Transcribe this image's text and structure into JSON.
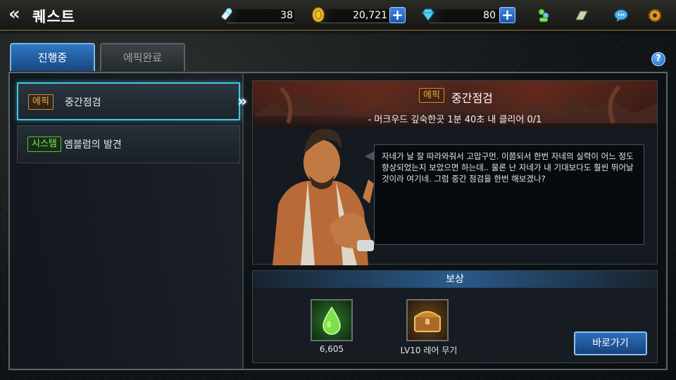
{
  "header": {
    "back_glyph": "«",
    "title": "퀘스트",
    "stamina": "38",
    "gold": "20,721",
    "gems": "80",
    "plus_glyph": "+",
    "icons": [
      "flashlight-icon",
      "gold-coin-icon",
      "diamond-icon",
      "people-icon",
      "inventory-icon",
      "chat-icon",
      "settings-gear-icon"
    ]
  },
  "tabs": [
    {
      "label": "진행중",
      "active": true
    },
    {
      "label": "에픽완료",
      "active": false
    }
  ],
  "help_glyph": "?",
  "quests": [
    {
      "tag": "에픽",
      "tag_type": "epic",
      "name": "중간점검",
      "selected": true
    },
    {
      "tag": "시스템",
      "tag_type": "system",
      "name": "엠블럼의 발견",
      "selected": false
    }
  ],
  "selected_arrow": "»",
  "detail": {
    "tag": "에픽",
    "title": "중간점검",
    "objective": "- 머크우드 깊숙한곳 1분 40초 내 클리어 0/1",
    "dialog": "자네가 날 잘 따라와줘서 고맙구먼. 이쯤되서 한번 자네의 실력이 어느 정도 향상되었는지 보았으면 하는데.. 물론 난 자네가 내 기대보다도 훨씬 뛰어날 것이라 여기네. 그럼 중간 점검을 한번 해보겠나?"
  },
  "reward": {
    "heading": "보상",
    "items": [
      {
        "label": "6,605",
        "icon": "exp-drop-icon"
      },
      {
        "label": "LV10 레어 무기",
        "icon": "treasure-chest-icon"
      }
    ],
    "go_button": "바로가기"
  },
  "colors": {
    "accent_blue": "#2f78c6",
    "epic_orange": "#f0a64a",
    "system_green": "#7ef05a",
    "selected_cyan": "#44c6e0"
  }
}
